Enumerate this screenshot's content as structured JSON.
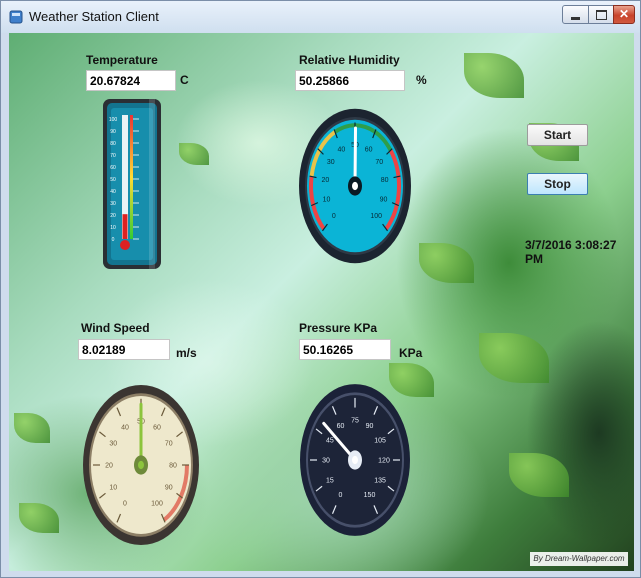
{
  "window": {
    "title": "Weather Station  Client",
    "controls": [
      "minimize",
      "maximize",
      "close"
    ]
  },
  "temperature": {
    "label": "Temperature",
    "value": "20.67824",
    "unit": "C",
    "gauge": {
      "type": "thermometer",
      "scale": [
        "100",
        "90",
        "80",
        "70",
        "60",
        "50",
        "40",
        "30",
        "20",
        "10",
        "0"
      ],
      "level_percent": 20.67824
    }
  },
  "humidity": {
    "label": "Relative Humidity",
    "value": "50.25866",
    "unit": "%",
    "gauge": {
      "type": "radial",
      "min": 0,
      "max": 100,
      "ticks": [
        "0",
        "10",
        "20",
        "30",
        "40",
        "50",
        "60",
        "70",
        "80",
        "90",
        "100"
      ],
      "needle_value": 50.25866
    }
  },
  "wind": {
    "label": "Wind Speed",
    "value": "8.02189",
    "unit": "m/s",
    "gauge": {
      "type": "radial",
      "min": 0,
      "max": 100,
      "ticks": [
        "0",
        "10",
        "20",
        "30",
        "40",
        "50",
        "60",
        "70",
        "80",
        "90",
        "100"
      ],
      "needle_value": 50
    }
  },
  "pressure": {
    "label": "Pressure KPa",
    "value": "50.16265",
    "unit": "KPa",
    "gauge": {
      "type": "radial",
      "min": 0,
      "max": 150,
      "ticks": [
        "0",
        "15",
        "30",
        "45",
        "60",
        "75",
        "90",
        "105",
        "120",
        "135",
        "150"
      ],
      "needle_value": 50.16265
    }
  },
  "controls": {
    "start_label": "Start",
    "stop_label": "Stop",
    "datetime": "3/7/2016 3:08:27 PM"
  },
  "credit": "By Dream-Wallpaper.com",
  "colors": {
    "titlebar": "#dbe7f5",
    "close": "#c8432b",
    "humidity_face": "#0bb4d6",
    "pressure_face": "#1b2238",
    "wind_face": "#eee8cc",
    "thermo_body": "#13748f"
  }
}
